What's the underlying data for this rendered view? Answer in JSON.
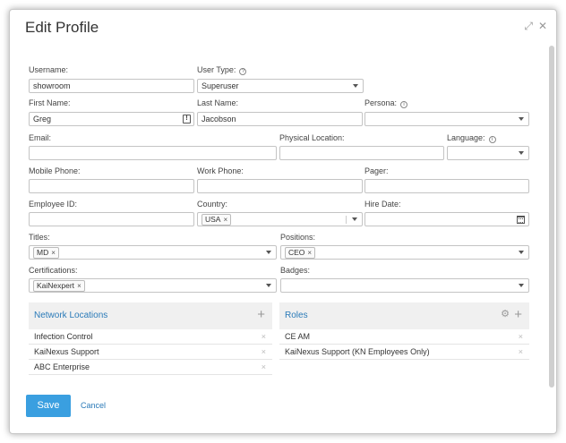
{
  "dialog": {
    "title": "Edit Profile",
    "expand_glyph": "⤢",
    "close_glyph": "✕"
  },
  "fields": {
    "username": {
      "label": "Username:",
      "value": "showroom"
    },
    "user_type": {
      "label": "User Type:",
      "value": "Superuser",
      "info_glyph": "?"
    },
    "first_name": {
      "label": "First Name:",
      "value": "Greg",
      "info_glyph": "!"
    },
    "last_name": {
      "label": "Last Name:",
      "value": "Jacobson"
    },
    "persona": {
      "label": "Persona:",
      "value": "",
      "info_glyph": "i"
    },
    "email": {
      "label": "Email:",
      "value": ""
    },
    "physical_location": {
      "label": "Physical Location:",
      "value": ""
    },
    "language": {
      "label": "Language:",
      "value": "",
      "info_glyph": "i"
    },
    "mobile_phone": {
      "label": "Mobile Phone:",
      "value": ""
    },
    "work_phone": {
      "label": "Work Phone:",
      "value": ""
    },
    "pager": {
      "label": "Pager:",
      "value": ""
    },
    "employee_id": {
      "label": "Employee ID:",
      "value": ""
    },
    "country": {
      "label": "Country:",
      "tag": "USA"
    },
    "hire_date": {
      "label": "Hire Date:",
      "value": ""
    },
    "titles": {
      "label": "Titles:",
      "tag": "MD"
    },
    "positions": {
      "label": "Positions:",
      "tag": "CEO"
    },
    "certifications": {
      "label": "Certifications:",
      "tag": "KaiNexpert"
    },
    "badges": {
      "label": "Badges:",
      "value": ""
    }
  },
  "tag_remove_glyph": "×",
  "network_locations": {
    "title": "Network Locations",
    "add_glyph": "+",
    "items": [
      "Infection Control",
      "KaiNexus Support",
      "ABC Enterprise"
    ],
    "remove_glyph": "×"
  },
  "roles": {
    "title": "Roles",
    "add_glyph": "+",
    "settings_glyph": "⚙",
    "items": [
      "CE AM",
      "KaiNexus Support (KN Employees Only)"
    ],
    "remove_glyph": "×"
  },
  "actions": {
    "save_label": "Save",
    "cancel_label": "Cancel"
  },
  "colors": {
    "accent": "#3a9fe0",
    "link": "#2a7ab8"
  }
}
